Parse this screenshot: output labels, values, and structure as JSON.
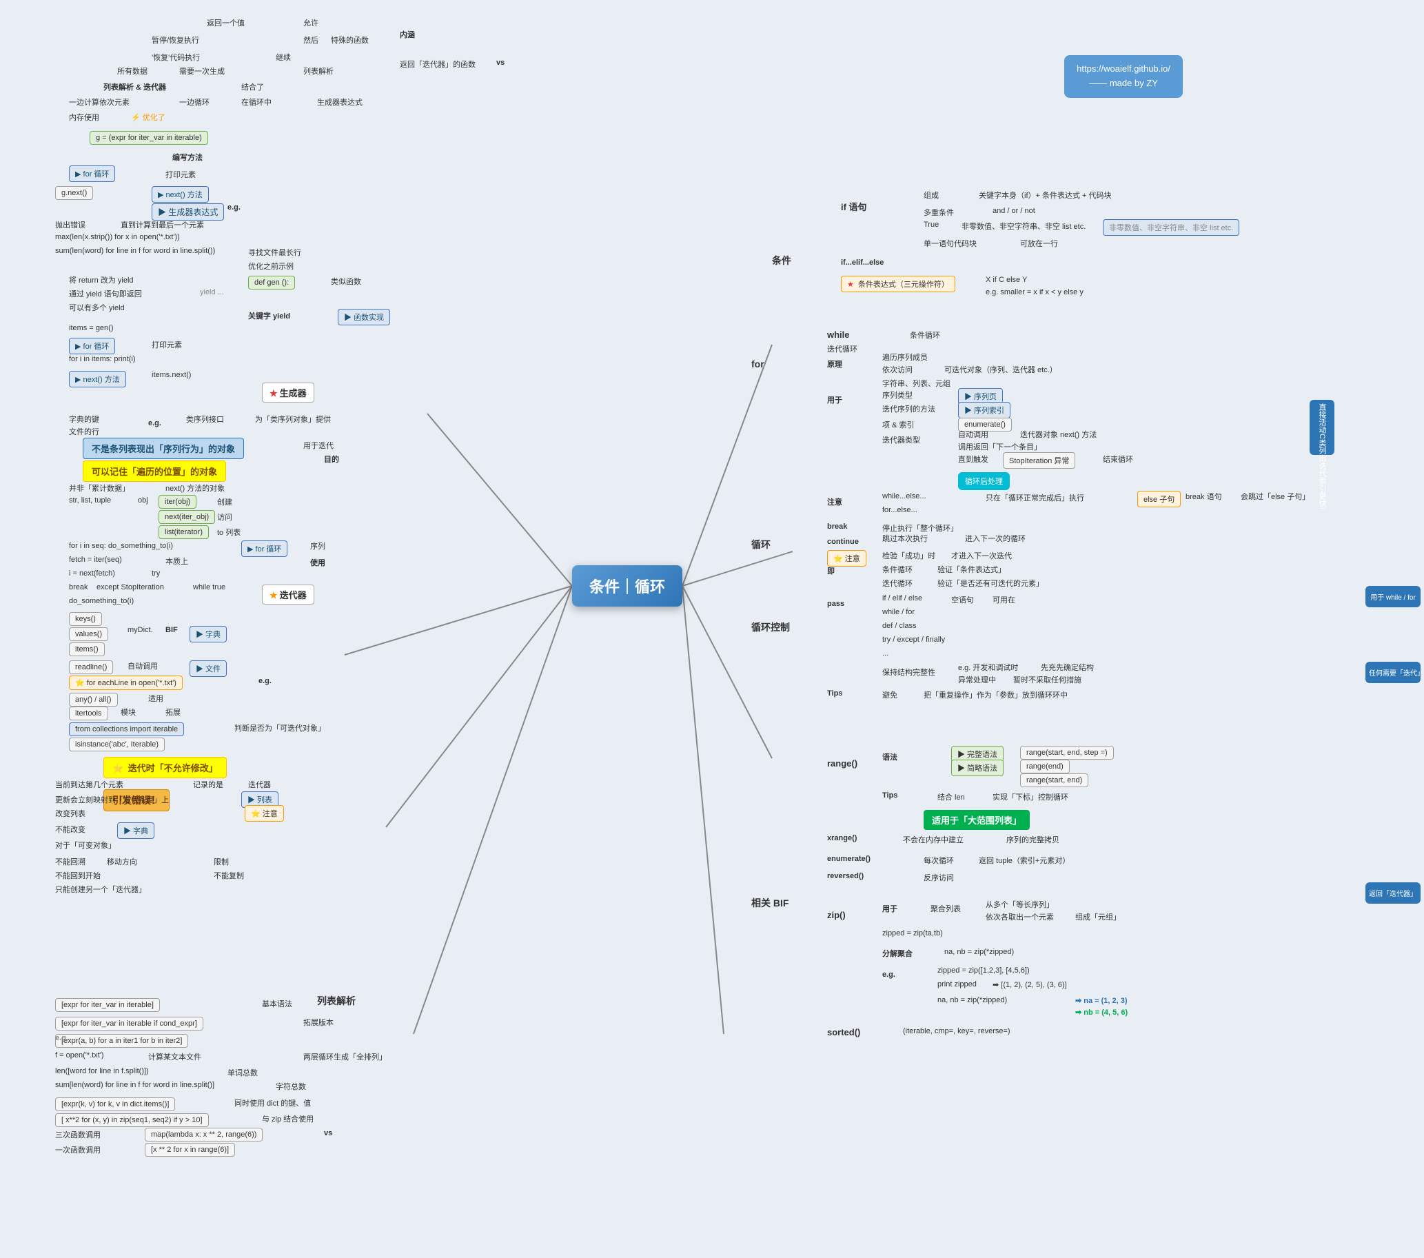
{
  "title": "条件｜循环",
  "info_box": {
    "line1": "https://woaielf.github.io/",
    "line2": "—— made by ZY"
  },
  "center": "条件｜循环",
  "sections": {
    "generator": "★ 生成器",
    "iterator": "★ 迭代器",
    "left_main": "编写方法",
    "condition": "条件",
    "if_statement": "if 语句",
    "for_loop": "for",
    "while_loop": "while",
    "loop": "循环",
    "loop_control": "循环控制",
    "related_bif": "相关 BIF",
    "list_comp": "列表解析"
  }
}
